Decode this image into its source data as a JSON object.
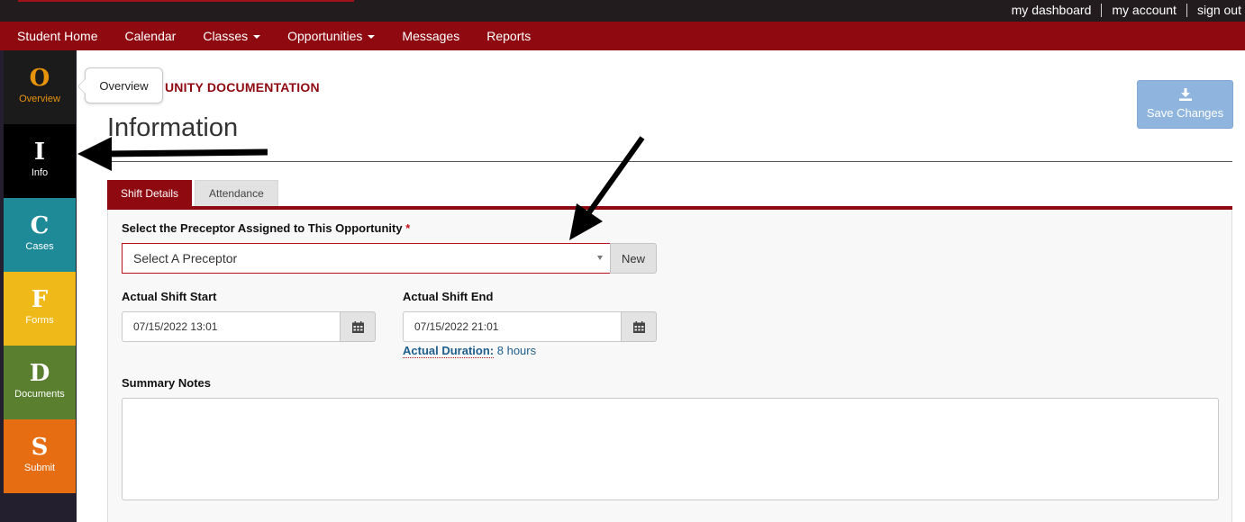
{
  "top_links": [
    "my dashboard",
    "my account",
    "sign out"
  ],
  "nav": {
    "items": [
      {
        "label": "Student Home"
      },
      {
        "label": "Calendar"
      },
      {
        "label": "Classes"
      },
      {
        "label": "Opportunities"
      },
      {
        "label": "Messages"
      },
      {
        "label": "Reports"
      }
    ]
  },
  "sidebar": {
    "items": [
      {
        "letter": "O",
        "label": "Overview",
        "color": "#1b1b1b"
      },
      {
        "letter": "I",
        "label": "Info",
        "color": "#000000"
      },
      {
        "letter": "C",
        "label": "Cases",
        "color": "#1e8a98"
      },
      {
        "letter": "F",
        "label": "Forms",
        "color": "#efb91a"
      },
      {
        "letter": "D",
        "label": "Documents",
        "color": "#5a7f2e"
      },
      {
        "letter": "S",
        "label": "Submit",
        "color": "#e66d12"
      }
    ]
  },
  "tooltip": {
    "text": "Overview"
  },
  "header": {
    "section_label": "UNITY DOCUMENTATION",
    "title": "Information",
    "save_label": "Save Changes"
  },
  "tabs": [
    {
      "label": "Shift Details",
      "active": true
    },
    {
      "label": "Attendance",
      "active": false
    }
  ],
  "form": {
    "preceptor_label": "Select the Preceptor Assigned to This Opportunity",
    "required_mark": "*",
    "preceptor_value": "Select A Preceptor",
    "new_label": "New",
    "shift_start_label": "Actual Shift Start",
    "shift_start_value": "07/15/2022 13:01",
    "shift_end_label": "Actual Shift End",
    "shift_end_value": "07/15/2022 21:01",
    "duration_label": "Actual Duration:",
    "duration_value": "8 hours",
    "notes_label": "Summary Notes",
    "notes_value": ""
  },
  "colors": {
    "brand_red": "#8e0a10",
    "save_button": "#8fb5de",
    "link_blue": "#1d5e8c"
  }
}
